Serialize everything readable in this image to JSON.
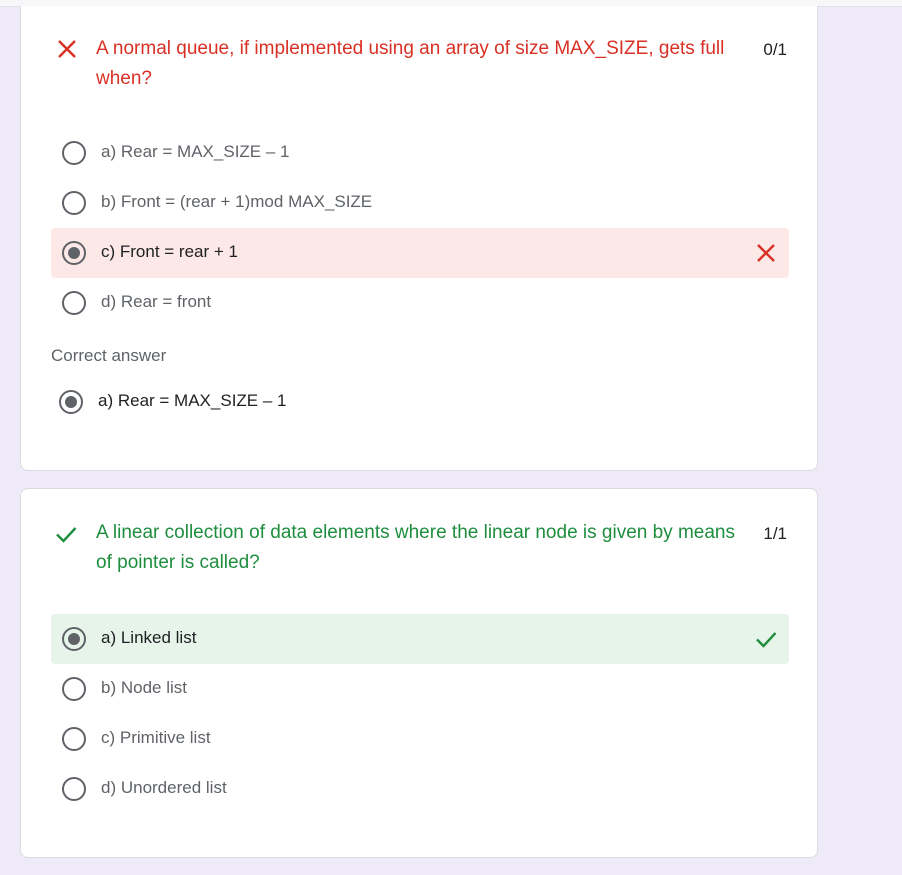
{
  "colors": {
    "wrong": "#d93025",
    "correct": "#1e8e3e",
    "wrong_bg": "#fce8e6",
    "correct_bg": "#e6f4ea",
    "page_bg": "#efeaf8"
  },
  "questions": [
    {
      "status_icon": "close-icon",
      "text": "A normal queue, if implemented using an array of size MAX_SIZE, gets full when?",
      "score": "0/1",
      "options": [
        {
          "label": "a) Rear = MAX_SIZE – 1",
          "selected": false
        },
        {
          "label": "b) Front = (rear + 1)mod MAX_SIZE",
          "selected": false
        },
        {
          "label": "c) Front = rear + 1",
          "selected": true,
          "result_icon": "close-icon"
        },
        {
          "label": "d) Rear = front",
          "selected": false
        }
      ],
      "correct_answer_caption": "Correct answer",
      "correct_answer": "a) Rear = MAX_SIZE – 1"
    },
    {
      "status_icon": "check-icon",
      "text": "A linear collection of data elements where the linear node is given by means of pointer is called?",
      "score": "1/1",
      "options": [
        {
          "label": "a) Linked list",
          "selected": true,
          "result_icon": "check-icon"
        },
        {
          "label": "b) Node list",
          "selected": false
        },
        {
          "label": "c) Primitive list",
          "selected": false
        },
        {
          "label": "d) Unordered list",
          "selected": false
        }
      ]
    }
  ]
}
